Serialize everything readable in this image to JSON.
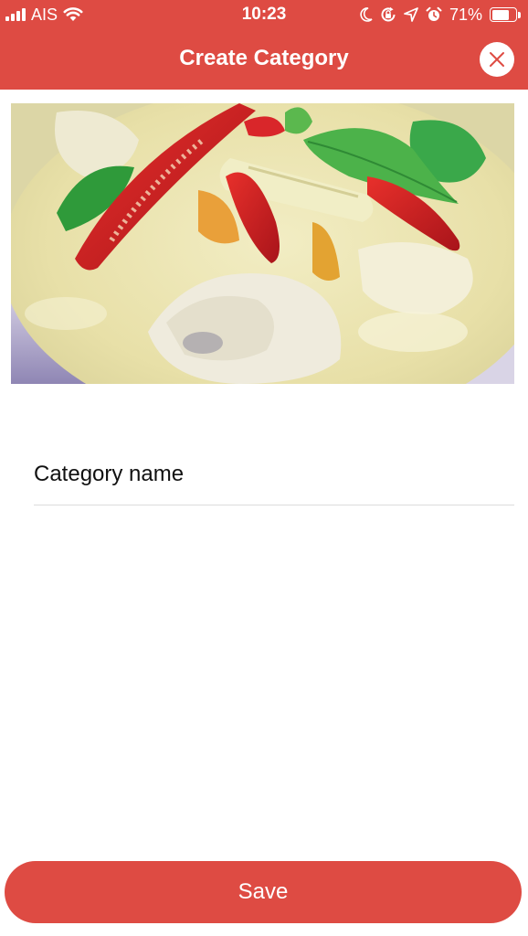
{
  "theme": {
    "accent": "#DE4B43",
    "background": "#FFFFFF",
    "text": "#111111",
    "divider": "#DCDCDC"
  },
  "status_bar": {
    "carrier": "AIS",
    "time": "10:23",
    "battery_percent": "71%",
    "battery_level": 0.71,
    "icons": [
      "signal-icon",
      "wifi-icon",
      "moon-icon",
      "rotation-lock-icon",
      "location-arrow-icon",
      "alarm-icon",
      "battery-icon"
    ]
  },
  "nav": {
    "title": "Create Category",
    "close_icon": "close-icon"
  },
  "image": {
    "description_icon": "food-photo"
  },
  "form": {
    "name_placeholder": "Category name",
    "name_value": ""
  },
  "actions": {
    "save_label": "Save"
  }
}
